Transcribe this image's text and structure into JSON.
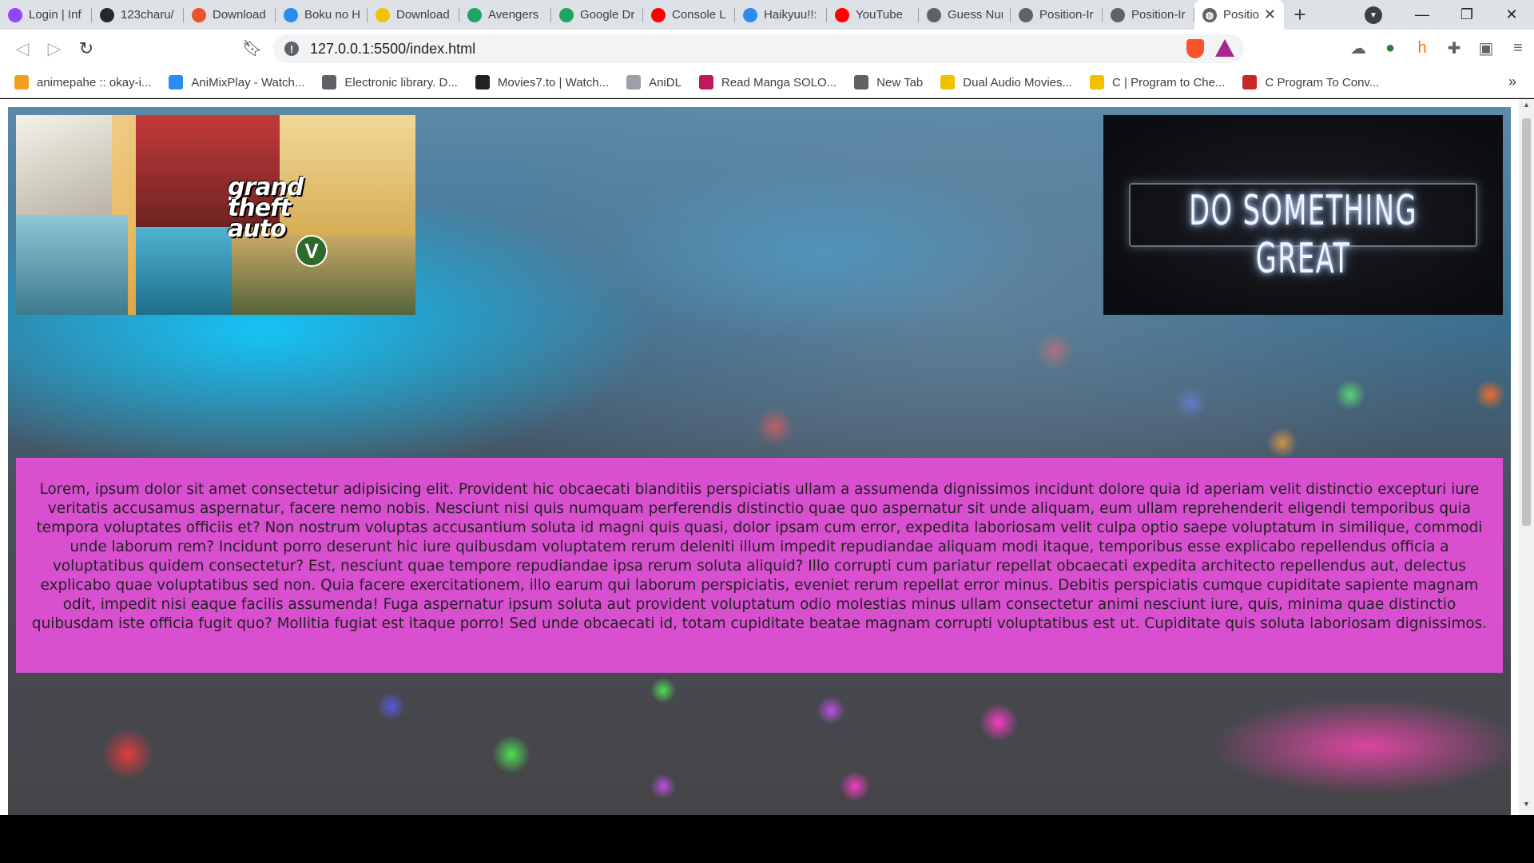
{
  "tabs": [
    {
      "label": "Login | Inf",
      "icon": "twitch-icon",
      "color": "#9146ff"
    },
    {
      "label": "123charu/",
      "icon": "github-icon",
      "color": "#24292e"
    },
    {
      "label": "Download",
      "icon": "x-icon",
      "color": "#e8542c"
    },
    {
      "label": "Boku no H",
      "icon": "animixplay-icon",
      "color": "#2a8cf0"
    },
    {
      "label": "Download",
      "icon": "download-site-icon",
      "color": "#f2c200"
    },
    {
      "label": "Avengers",
      "icon": "google-drive-icon",
      "color": "#1fa463"
    },
    {
      "label": "Google Dr",
      "icon": "google-drive-icon",
      "color": "#1fa463"
    },
    {
      "label": "Console L",
      "icon": "youtube-icon",
      "color": "#ff0000"
    },
    {
      "label": "Haikyuu!!:",
      "icon": "animixplay-icon",
      "color": "#2a8cf0"
    },
    {
      "label": "YouTube",
      "icon": "youtube-icon",
      "color": "#ff0000"
    },
    {
      "label": "Guess Nur",
      "icon": "globe-icon",
      "color": "#5f6368"
    },
    {
      "label": "Position-Ir",
      "icon": "globe-icon",
      "color": "#5f6368"
    },
    {
      "label": "Position-Ir",
      "icon": "globe-icon",
      "color": "#5f6368"
    }
  ],
  "active_tab": {
    "label": "Positio",
    "icon": "globe-icon"
  },
  "toolbar": {
    "url": "127.0.0.1:5500/index.html"
  },
  "bookmarks": [
    {
      "label": "animepahe :: okay-i...",
      "icon": "animepahe-icon",
      "color": "#f0a020"
    },
    {
      "label": "AniMixPlay - Watch...",
      "icon": "animixplay-icon",
      "color": "#2a8cf0"
    },
    {
      "label": "Electronic library. D...",
      "icon": "v-icon",
      "color": "#5f6368"
    },
    {
      "label": "Movies7.to | Watch...",
      "icon": "play-icon",
      "color": "#202124"
    },
    {
      "label": "AniDL",
      "icon": "anidl-icon",
      "color": "#9aa0a6"
    },
    {
      "label": "Read Manga SOLO...",
      "icon": "manga-icon",
      "color": "#c2185b"
    },
    {
      "label": "New Tab",
      "icon": "globe-icon",
      "color": "#5f6368"
    },
    {
      "label": "Dual Audio Movies...",
      "icon": "download-site-icon",
      "color": "#f2c200"
    },
    {
      "label": "C | Program to Che...",
      "icon": "geeks-icon",
      "color": "#f2c200"
    },
    {
      "label": "C Program To Conv...",
      "icon": "tg-icon",
      "color": "#c62828"
    }
  ],
  "page": {
    "gta_logo_line1": "grand",
    "gta_logo_line2": "theft",
    "gta_logo_line3": "auto",
    "gta_v": "V",
    "neon_text": "DO SOMETHING GREAT",
    "lorem": "Lorem, ipsum dolor sit amet consectetur adipisicing elit. Provident hic obcaecati blanditiis perspiciatis ullam a assumenda dignissimos incidunt dolore quia id aperiam velit distinctio excepturi iure veritatis accusamus aspernatur, facere nemo nobis. Nesciunt nisi quis numquam perferendis distinctio quae quo aspernatur sit unde aliquam, eum ullam reprehenderit eligendi temporibus quia tempora voluptates officiis et? Non nostrum voluptas accusantium soluta id magni quis quasi, dolor ipsam cum error, expedita laboriosam velit culpa optio saepe voluptatum in similique, commodi unde laborum rem? Incidunt porro deserunt hic iure quibusdam voluptatem rerum deleniti illum impedit repudiandae aliquam modi itaque, temporibus esse explicabo repellendus officia a voluptatibus quidem consectetur? Est, nesciunt quae tempore repudiandae ipsa rerum soluta aliquid? Illo corrupti cum pariatur repellat obcaecati expedita architecto repellendus aut, delectus explicabo quae voluptatibus sed non. Quia facere exercitationem, illo earum qui laborum perspiciatis, eveniet rerum repellat error minus. Debitis perspiciatis cumque cupiditate sapiente magnam odit, impedit nisi eaque facilis assumenda! Fuga aspernatur ipsum soluta aut provident voluptatum odio molestias minus ullam consectetur animi nesciunt iure, quis, minima quae distinctio quibusdam iste officia fugit quo? Mollitia fugiat est itaque porro! Sed unde obcaecati id, totam cupiditate beatae magnam corrupti voluptatibus est ut. Cupiditate quis soluta laboriosam dignissimos.",
    "lorem_box_color": "#d84fd0"
  }
}
